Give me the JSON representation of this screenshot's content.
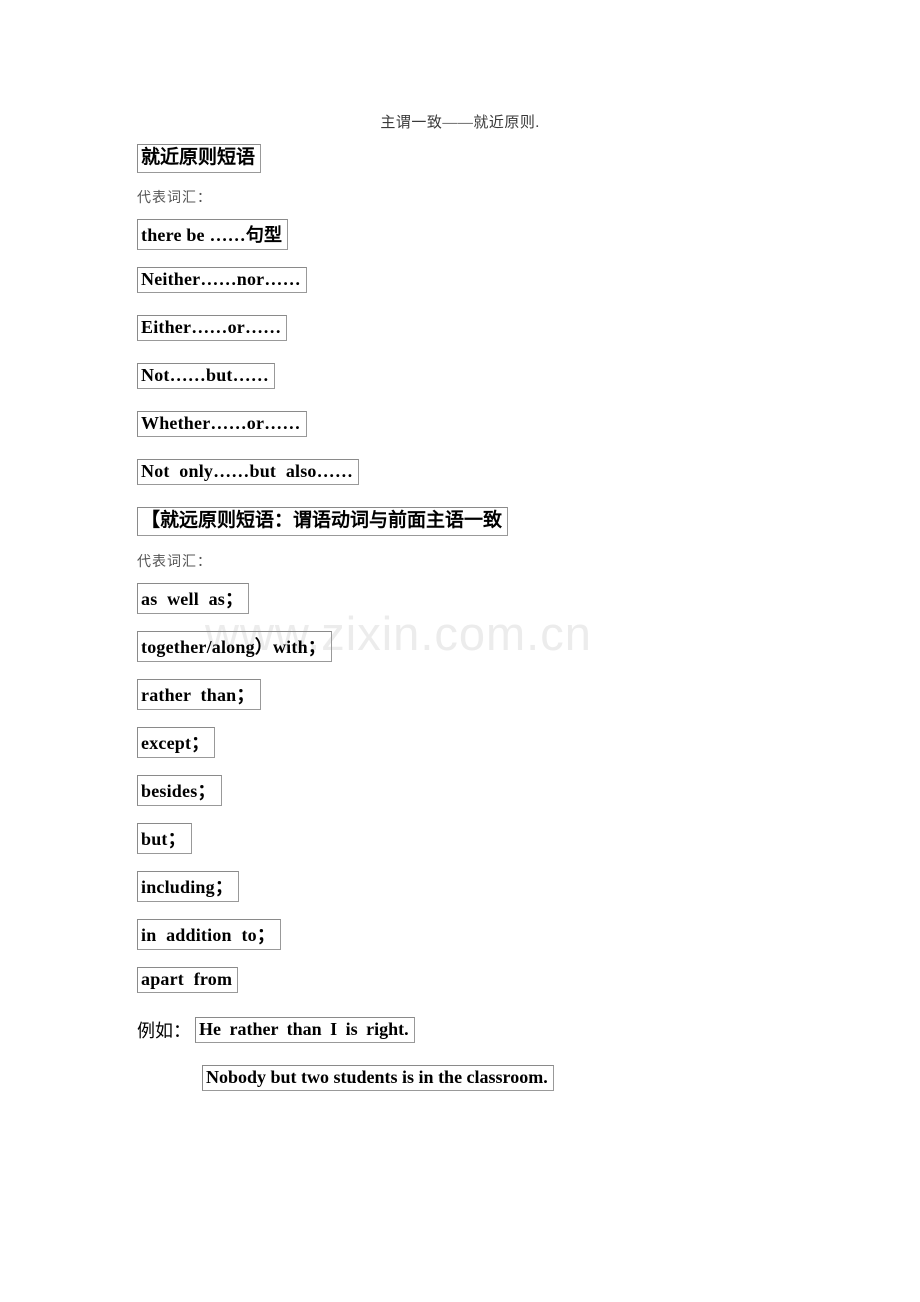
{
  "document": {
    "title": "主谓一致——就近原则.",
    "watermark": "www.zixin.com.cn"
  },
  "section_one": {
    "heading": "就近原则短语",
    "vocab_label": "代表词汇：",
    "phrases": [
      "there be ……句型",
      "Neither……nor……",
      "Either……or……",
      "Not……but……",
      "Whether……or……",
      "Not only……but also……"
    ]
  },
  "section_two": {
    "heading": "【就远原则短语：谓语动词与前面主语一致",
    "vocab_label": "代表词汇：",
    "phrases": [
      "as well as；",
      "together/along）with；",
      "rather than；",
      "except；",
      "besides；",
      "but；",
      "including；",
      "in addition to；",
      "apart from"
    ]
  },
  "examples": {
    "label": "例如：",
    "sentences": [
      "He rather than I is right.",
      "Nobody but two students is in the classroom."
    ]
  }
}
